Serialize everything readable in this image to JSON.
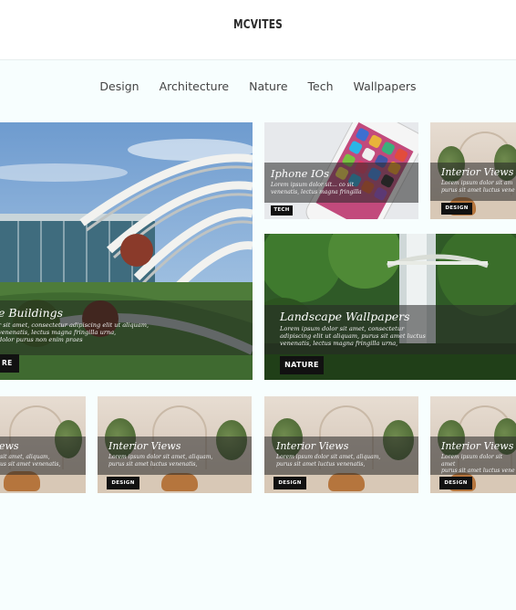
{
  "header": {
    "logo": "MCVITES"
  },
  "nav": {
    "items": [
      "Design",
      "Architecture",
      "Nature",
      "Tech",
      "Wallpapers"
    ]
  },
  "cards": {
    "buildings": {
      "title": "e Buildings",
      "desc": "r sit amet, consectetur adipiscing elit ut aliquam,\nvenenatis, lectus magna fringilla urna,\ndolor purus non enim praes",
      "badge": "RE"
    },
    "iphone": {
      "title": "Iphone IOs",
      "desc": "Lorem ipsum dolor sit... co sit\nvenenatis, lectus magna fringilla",
      "badge": "TECH"
    },
    "interior_top": {
      "title": "Interior Views",
      "desc": "Lorem ipsum dolor sit am\npurus sit amet luctus vene",
      "badge": "DESIGN"
    },
    "landscape": {
      "title": "Landscape Wallpapers",
      "desc": "Lorem ipsum dolor sit amet, consectetur\nadipiscing elit ut aliquam, purus sit amet luctus\nvenenatis, lectus magna fringilla urna,",
      "badge": "NATURE"
    },
    "row3_a": {
      "title": "ews",
      "desc": "sit amet, aliquam,\nus sit amet venenatis,",
      "badge": ""
    },
    "row3_b": {
      "title": "Interior Views",
      "desc": "Lorem ipsum dolor sit amet, aliquam,\npurus sit amet luctus venenatis,",
      "badge": "DESIGN"
    },
    "row3_c": {
      "title": "Interior Views",
      "desc": "Lorem ipsum dolor sit amet, aliquam,\npurus sit amet luctus venenatis,",
      "badge": "DESIGN"
    },
    "row3_d": {
      "title": "Interior Views",
      "desc": "Lorem ipsum dolor sit amet\npurus sit amet luctus vene",
      "badge": "DESIGN"
    }
  },
  "colors": {
    "page_bg": "#f7fefe",
    "header_bg": "#ffffff",
    "badge_bg": "#111111",
    "overlay": "rgba(40,40,40,0.55)"
  }
}
